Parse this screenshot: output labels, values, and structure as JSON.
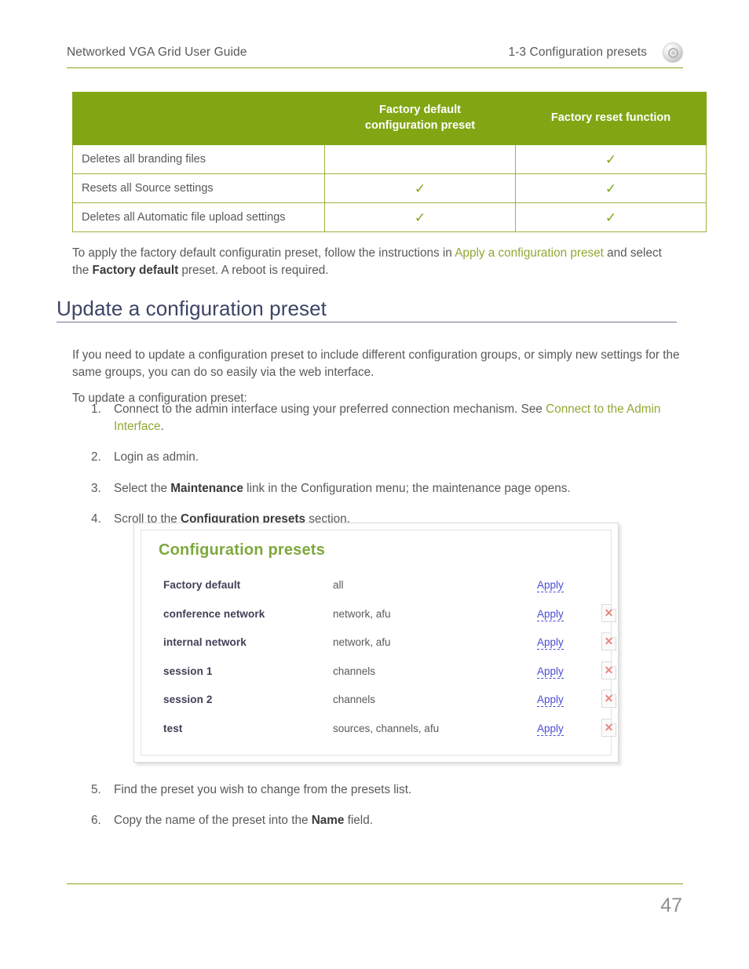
{
  "header": {
    "left_title": "Networked VGA Grid User Guide",
    "right_title": "1-3 Configuration presets",
    "logo_icon": "company-logo-icon"
  },
  "comparison_table": {
    "columns": [
      "",
      "Factory default configuration preset",
      "Factory reset function"
    ],
    "column_a_line1": "Factory default",
    "column_a_line2": "configuration preset",
    "column_b": "Factory reset function",
    "check_glyph": "✓",
    "rows": [
      {
        "label": "Deletes all branding files",
        "factory_default_preset": "",
        "factory_reset_function": "✓"
      },
      {
        "label": "Resets all Source settings",
        "factory_default_preset": "✓",
        "factory_reset_function": "✓"
      },
      {
        "label": "Deletes all Automatic file upload settings",
        "factory_default_preset": "✓",
        "factory_reset_function": "✓"
      }
    ]
  },
  "intro_paragraph": {
    "part1": "To apply the factory default configuratin preset, follow the instructions in ",
    "link": "Apply a configuration preset",
    "part2": " and select the ",
    "bold": "Factory default",
    "part3": " preset. A reboot is required."
  },
  "section": {
    "heading": "Update a configuration preset",
    "paragraph_1": "If you need to update a configuration preset to include different configuration groups, or simply new settings for the same groups, you can do so easily via the web interface.",
    "paragraph_2": "To update a configuration preset:"
  },
  "steps": [
    {
      "number": "1.",
      "text_before": "Connect to the admin interface using your preferred connection mechanism. See ",
      "link": "Connect to the Admin Interface",
      "text_after": "."
    },
    {
      "number": "2.",
      "text_before": "Login as admin.",
      "link": "",
      "text_after": ""
    },
    {
      "number": "3.",
      "text_before": "Select the ",
      "bold": "Maintenance",
      "text_after": " link in the Configuration menu; the maintenance page opens."
    },
    {
      "number": "4.",
      "text_before": "Scroll to the ",
      "bold": "Configuration presets",
      "text_after": " section."
    }
  ],
  "steps_tail": [
    {
      "number": "5.",
      "text_before": "Find the preset you wish to change from the presets list.",
      "bold": "",
      "text_after": ""
    },
    {
      "number": "6.",
      "text_before": "Copy the name of the preset into the ",
      "bold": "Name",
      "text_after": " field."
    }
  ],
  "screenshot": {
    "title": "Configuration presets",
    "apply_label": "Apply",
    "delete_icon": "delete-page-x-icon",
    "presets": [
      {
        "name": "Factory default",
        "groups": "all",
        "apply": "Apply",
        "deletable": false
      },
      {
        "name": "conference network",
        "groups": "network, afu",
        "apply": "Apply",
        "deletable": true
      },
      {
        "name": "internal network",
        "groups": "network, afu",
        "apply": "Apply",
        "deletable": true
      },
      {
        "name": "session 1",
        "groups": "channels",
        "apply": "Apply",
        "deletable": true
      },
      {
        "name": "session 2",
        "groups": "channels",
        "apply": "Apply",
        "deletable": true
      },
      {
        "name": "test",
        "groups": "sources, channels, afu",
        "apply": "Apply",
        "deletable": true
      }
    ]
  },
  "footer": {
    "page_number": "47"
  },
  "colors": {
    "brand_green": "#82a613",
    "rule_green": "#8aa61a",
    "link_green": "#8fa833",
    "heading_navy": "#3d4465",
    "check_green": "#7fa70f",
    "apply_blue": "#4b4bd6",
    "delete_red": "#e9857e",
    "body_gray": "#595959"
  }
}
